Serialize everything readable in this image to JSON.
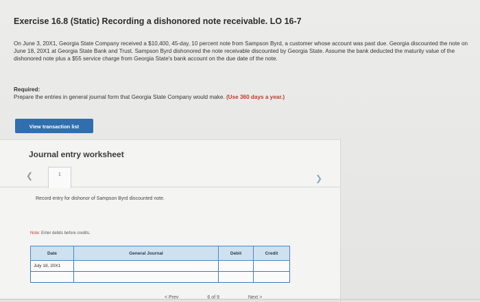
{
  "header": {
    "title": "Exercise 16.8 (Static) Recording a dishonored note receivable. LO 16-7"
  },
  "problem": {
    "text": "On June 3, 20X1, Georgia State Company received a $10,400, 45-day, 10 percent note from Sampson Byrd, a customer whose account was past due. Georgia discounted the note on June 18, 20X1 at Georgia State Bank and Trust. Sampson Byrd dishonored the note receivable discounted by Georgia State. Assume the bank deducted the maturity value of the dishonored note plus a $55 service charge from Georgia State's bank account on the due date of the note."
  },
  "required": {
    "label": "Required:",
    "text": "Prepare the entries in general journal form that Georgia State Company would make.",
    "emphasis": "(Use 360 days a year.)"
  },
  "buttons": {
    "view_transaction_list": "View transaction list"
  },
  "worksheet": {
    "title": "Journal entry worksheet",
    "current_tab": "1",
    "instruction": "Record entry for dishonor of Sampson Byrd discounted note.",
    "note_label": "Note:",
    "note_text": "Enter debits before credits."
  },
  "journal_table": {
    "columns": [
      "Date",
      "General Journal",
      "Debit",
      "Credit"
    ],
    "rows": [
      {
        "date": "July 18, 20X1",
        "account": "",
        "debit": "",
        "credit": ""
      },
      {
        "date": "",
        "account": "",
        "debit": "",
        "credit": ""
      }
    ]
  },
  "pager": {
    "prev": "< Prev",
    "position": "6 of 9",
    "next": "Next >"
  },
  "colors": {
    "button_bg": "#2f6fae",
    "table_header_bg": "#cfe0ef",
    "table_border": "#3a7ac0",
    "emphasis": "#c0392b"
  }
}
